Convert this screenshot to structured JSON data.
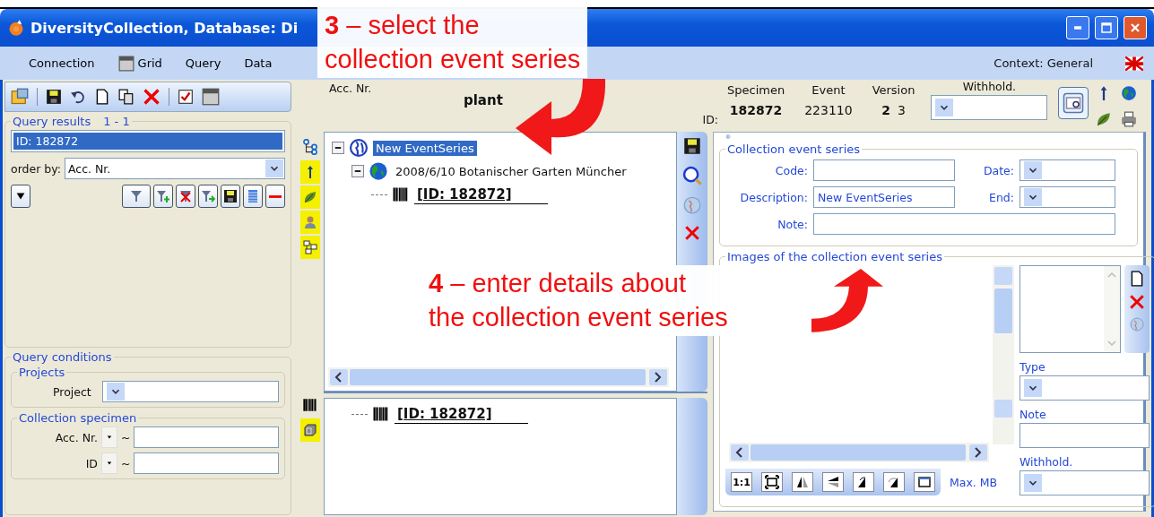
{
  "window": {
    "title": "DiversityCollection, Database: Di"
  },
  "menu": [
    {
      "label": "Connection",
      "kind": "text"
    },
    {
      "label": "Grid",
      "kind": "grid"
    },
    {
      "label": "Query",
      "kind": "text"
    },
    {
      "label": "Data",
      "kind": "text"
    }
  ],
  "context": "Context: General",
  "query_results": {
    "title": "Query results",
    "count": "1 - 1",
    "items": [
      {
        "label": "ID: 182872",
        "selected": true
      }
    ]
  },
  "order_by": {
    "label": "order by:",
    "value": "Acc. Nr."
  },
  "query_conditions": {
    "title": "Query conditions",
    "projects": {
      "title": "Projects",
      "label": "Project"
    },
    "collection_specimen": {
      "title": "Collection specimen",
      "fields": [
        {
          "label": "Acc. Nr.",
          "operator": "~"
        },
        {
          "label": "ID",
          "operator": "~"
        }
      ]
    }
  },
  "header": {
    "acc_label": "Acc. Nr.",
    "taxon": "plant",
    "id_label": "ID:",
    "withhold_label": "Withhold.",
    "columns": [
      {
        "label": "Specimen",
        "values": [
          {
            "text": "182872",
            "bold": true
          }
        ]
      },
      {
        "label": "Event",
        "values": [
          {
            "text": "223110",
            "bold": false
          }
        ]
      },
      {
        "label": "Version",
        "values": [
          {
            "text": "2",
            "bold": true
          },
          {
            "text": "3",
            "bold": false
          }
        ]
      }
    ]
  },
  "tree": [
    {
      "label": "New EventSeries",
      "kind": "series",
      "selected": true,
      "expanded": true,
      "children": [
        {
          "label": "2008/6/10 Botanischer Garten Müncher",
          "kind": "event",
          "selected": false,
          "expanded": true,
          "children": [
            {
              "label": "[ID: 182872]",
              "kind": "specimen",
              "selected": false
            }
          ]
        }
      ]
    }
  ],
  "lower_tree": [
    {
      "label": "[ID: 182872]",
      "kind": "specimen",
      "selected": false
    }
  ],
  "event_series": {
    "title": "Collection event series",
    "code_label": "Code:",
    "date_label": "Date:",
    "description_label": "Description:",
    "description": "New EventSeries",
    "end_label": "End:",
    "note_label": "Note:"
  },
  "images": {
    "title": "Images of the collection event series",
    "type_label": "Type",
    "note_label": "Note",
    "withhold_label": "Withhold.",
    "max_label": "Max. MB",
    "zoom_label": "1:1"
  },
  "callouts": [
    {
      "lines": [
        "**3** – select the",
        "collection event series"
      ]
    },
    {
      "lines": [
        "**4** – enter details about",
        "the collection event series"
      ]
    }
  ]
}
